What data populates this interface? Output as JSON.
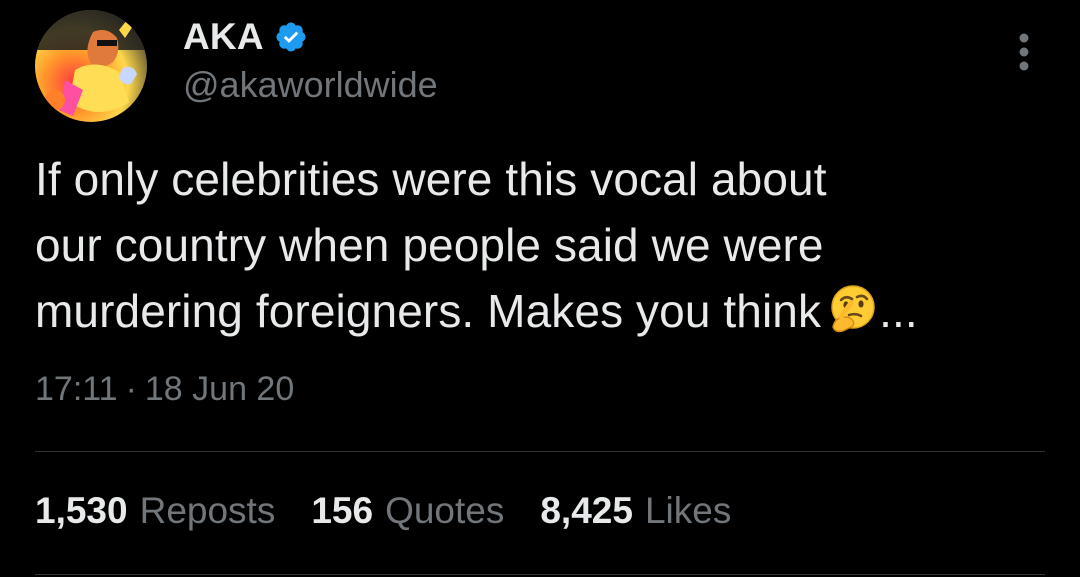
{
  "tweet": {
    "author": {
      "display_name": "AKA",
      "handle": "@akaworldwide",
      "verified": true,
      "avatar_icon": "profile-photo"
    },
    "more_icon": "more-vertical-icon",
    "text": "If only celebrities were this vocal about\nour country when people said we were\nmurdering foreigners. Makes you think",
    "text_emoji": "thinking-face-emoji",
    "text_suffix": "...",
    "time": "17:11",
    "separator": "·",
    "date": "18 Jun 20",
    "stats": [
      {
        "count": "1,530",
        "label": "Reposts"
      },
      {
        "count": "156",
        "label": "Quotes"
      },
      {
        "count": "8,425",
        "label": "Likes"
      }
    ]
  },
  "colors": {
    "background": "#000000",
    "primary_text": "#e7e9ea",
    "secondary_text": "#71767b",
    "verified_blue": "#1d9bf0",
    "divider": "#2f3336"
  }
}
